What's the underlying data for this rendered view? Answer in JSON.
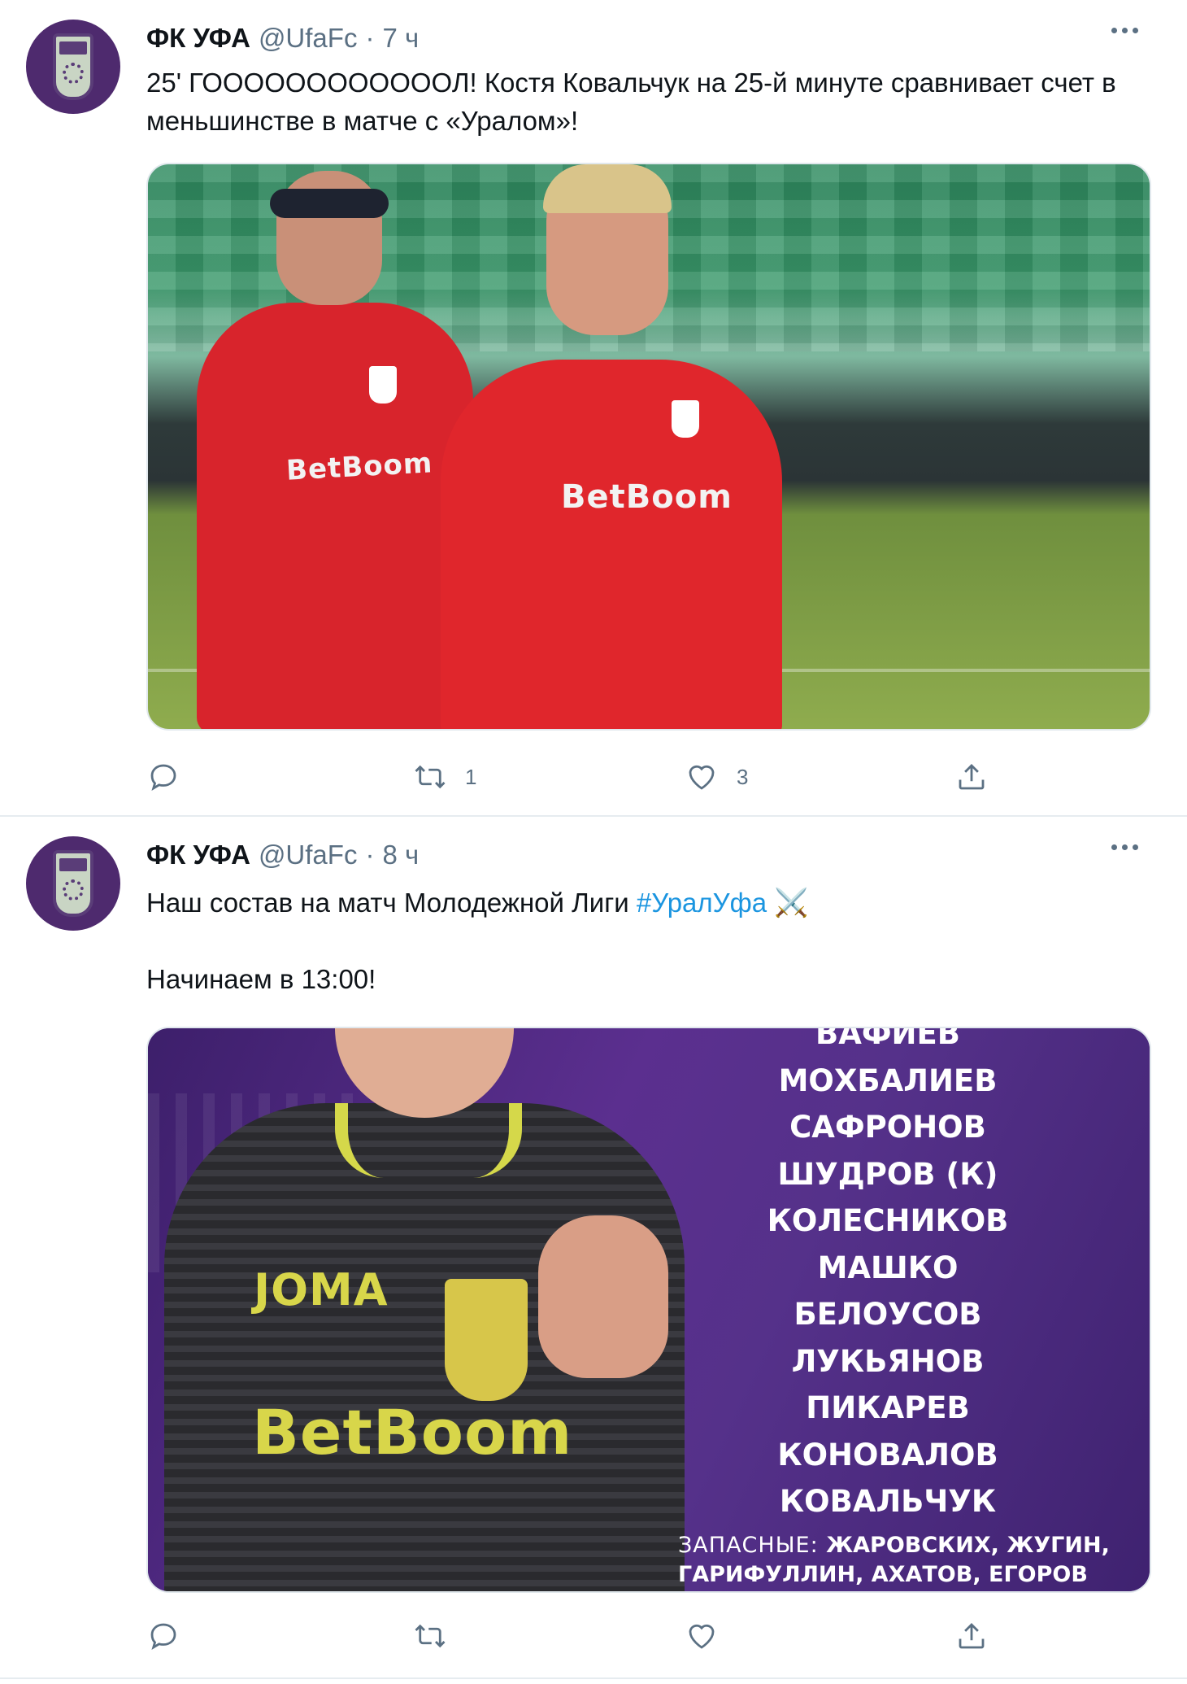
{
  "tweets": [
    {
      "author_name": "ФК УФА",
      "handle": "@UfaFc",
      "separator": "·",
      "time": "7 ч",
      "text": "25' ГООООООООООООЛ! Костя Ковальчук на 25-й минуте сравнивает счет в меньшинстве в матче с «Уралом»!",
      "photo_sponsor": "BetBoom",
      "photo_sponsor_2": "BetBoom",
      "counts": {
        "reply": "",
        "retweet": "1",
        "like": "3"
      }
    },
    {
      "author_name": "ФК УФА",
      "handle": "@UfaFc",
      "separator": "·",
      "time": "8 ч",
      "text_before_hashtag": "Наш состав на матч Молодежной Лиги ",
      "hashtag": "#УралУфа",
      "emoji": "⚔️",
      "text_line_2": "Начинаем в 13:00!",
      "photo_sponsor": "BetBoom",
      "photo_brand": "ЈОМА",
      "lineup": [
        "ВАФИЕВ",
        "МОХБАЛИЕВ",
        "САФРОНОВ",
        "ШУДРОВ (К)",
        "КОЛЕСНИКОВ",
        "МАШКО",
        "БЕЛОУСОВ",
        "ЛУКЬЯНОВ",
        "ПИКАРЕВ",
        "КОНОВАЛОВ",
        "КОВАЛЬЧУК"
      ],
      "subs_label": "ЗАПАСНЫЕ:",
      "subs_line_1": "ЖАРОВСКИХ, ЖУГИН,",
      "subs_line_2": "ГАРИФУЛЛИН, АХАТОВ, ЕГОРОВ",
      "counts": {
        "reply": "",
        "retweet": "",
        "like": ""
      }
    }
  ],
  "icons": {
    "avatar": "club-crest-icon",
    "more": "more-horizontal-icon",
    "reply": "reply-icon",
    "retweet": "retweet-icon",
    "like": "heart-icon",
    "share": "share-icon"
  },
  "colors": {
    "text": "#0f1419",
    "secondary": "#5b7083",
    "link": "#1b95e0",
    "avatar_bg": "#4e2a6e",
    "lineup_bg": "#4c2a7a"
  }
}
